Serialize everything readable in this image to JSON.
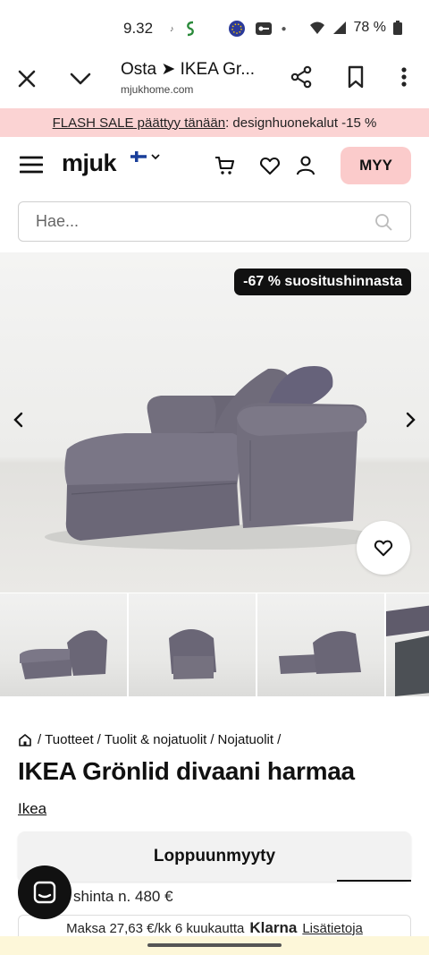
{
  "status_bar": {
    "time": "9.32",
    "battery": "78 %"
  },
  "browser": {
    "title": "Osta ➤ IKEA Gr...",
    "url": "mjukhome.com"
  },
  "flash_sale": {
    "link_text": "FLASH SALE päättyy tänään",
    "rest_text": ": designhuonekalut -15 %"
  },
  "header": {
    "logo": "mjuk",
    "sell_button": "MYY"
  },
  "search": {
    "placeholder": "Hae..."
  },
  "hero": {
    "discount_badge": "-67 % suositushinnasta"
  },
  "breadcrumb": {
    "items": [
      "Tuotteet",
      "Tuolit & nojatuolit",
      "Nojatuolit"
    ],
    "separator": "/"
  },
  "product": {
    "title": "IKEA Grönlid divaani harmaa",
    "brand": "Ikea",
    "status_button": "Loppuunmyyty",
    "price_text": "shinta n. 480 €"
  },
  "klarna": {
    "text": "Maksa 27,63 €/kk 6 kuukautta",
    "brand": "Klarna",
    "more": "Lisätietoja"
  },
  "colors": {
    "flash_bg": "#fbd3d3",
    "sell_button_bg": "#fbcbcb",
    "sofa": "#6e6a78"
  }
}
